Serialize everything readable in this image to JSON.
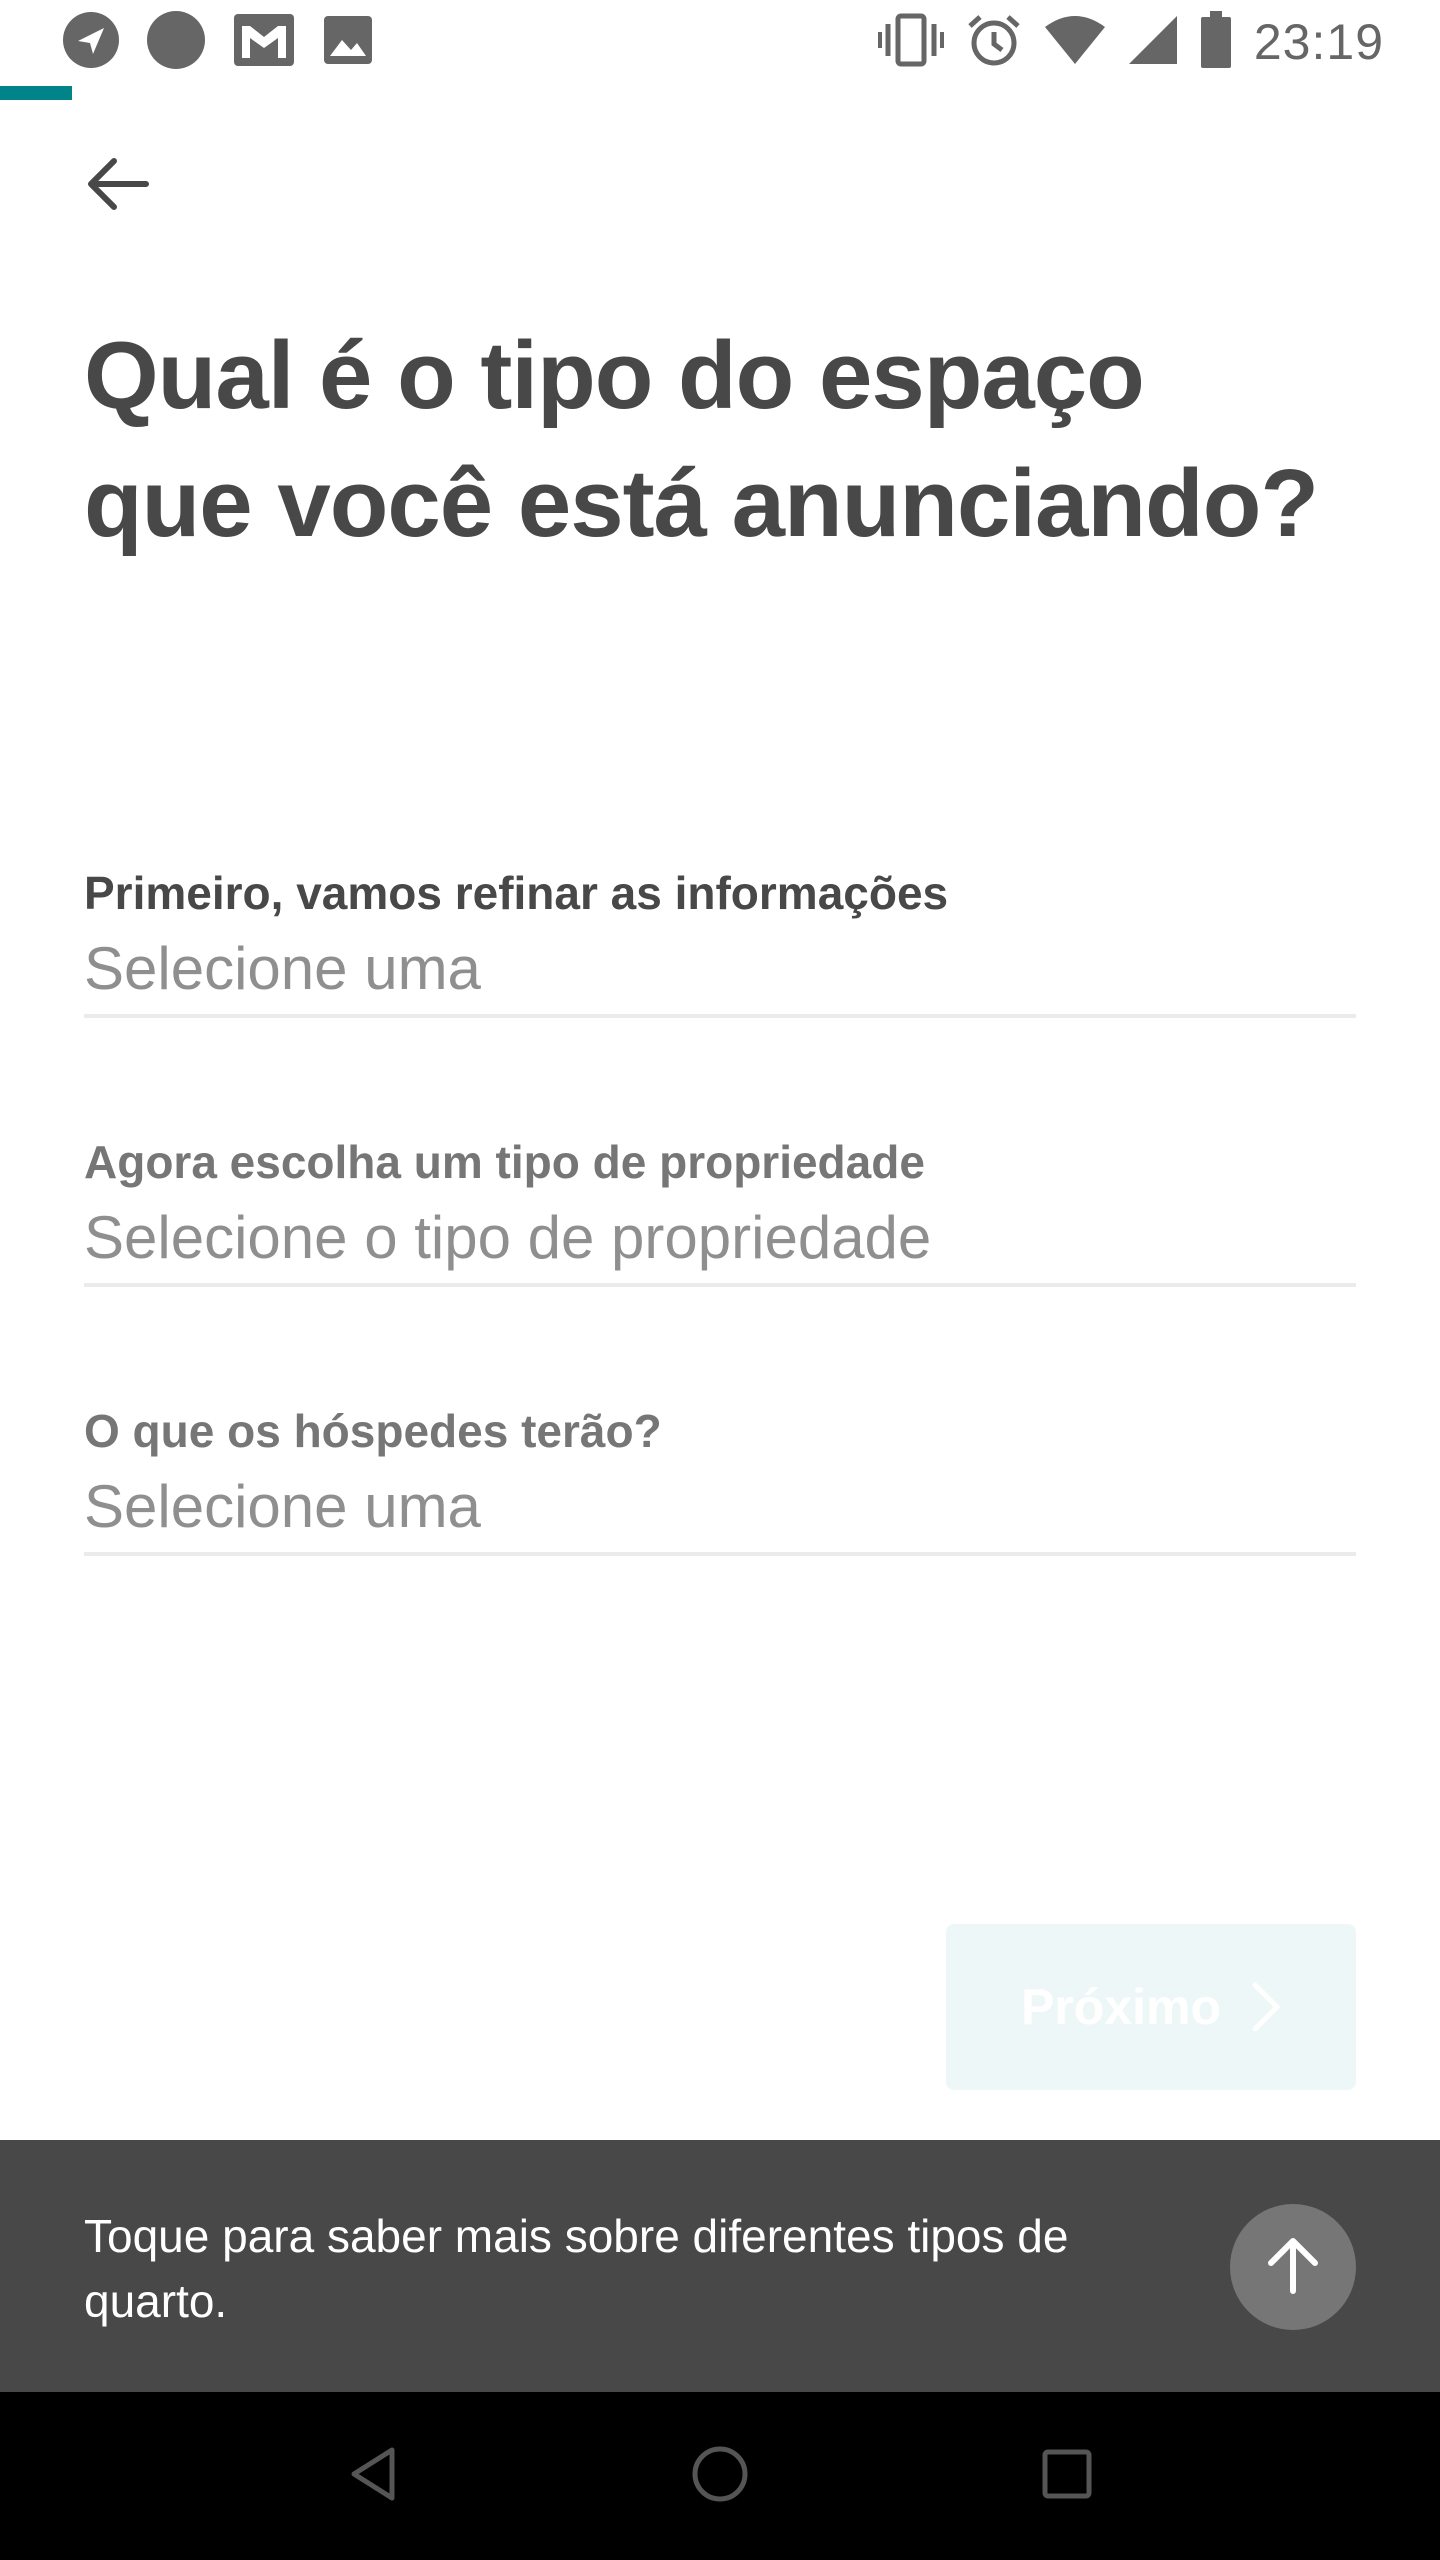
{
  "status_bar": {
    "time": "23:19",
    "left_icons": [
      "navigation-icon",
      "circle-notification-icon",
      "gmail-icon",
      "image-icon"
    ],
    "right_icons": [
      "vibrate-icon",
      "alarm-icon",
      "wifi-icon",
      "signal-icon",
      "battery-icon"
    ]
  },
  "header": {
    "back_icon": "arrow-left-icon",
    "title": "Qual é o tipo do espaço que você está anunciando?"
  },
  "form": {
    "fields": [
      {
        "label": "Primeiro, vamos refinar as informações",
        "placeholder": "Selecione uma"
      },
      {
        "label": "Agora escolha um tipo de propriedade",
        "placeholder": "Selecione o tipo de propriedade"
      },
      {
        "label": "O que os hóspedes terão?",
        "placeholder": "Selecione uma"
      }
    ]
  },
  "footer": {
    "next_label": "Próximo",
    "next_icon": "chevron-right-icon",
    "info_text": "Toque para saber mais sobre diferentes tipos de quarto.",
    "up_icon": "arrow-up-icon"
  },
  "nav_bar": {
    "icons": [
      "back-triangle-icon",
      "home-circle-icon",
      "recents-square-icon"
    ]
  },
  "colors": {
    "accent": "#008489",
    "text_dark": "#484848",
    "text_muted": "#767676",
    "info_bar_bg": "#484848",
    "nav_bar_bg": "#000000"
  }
}
